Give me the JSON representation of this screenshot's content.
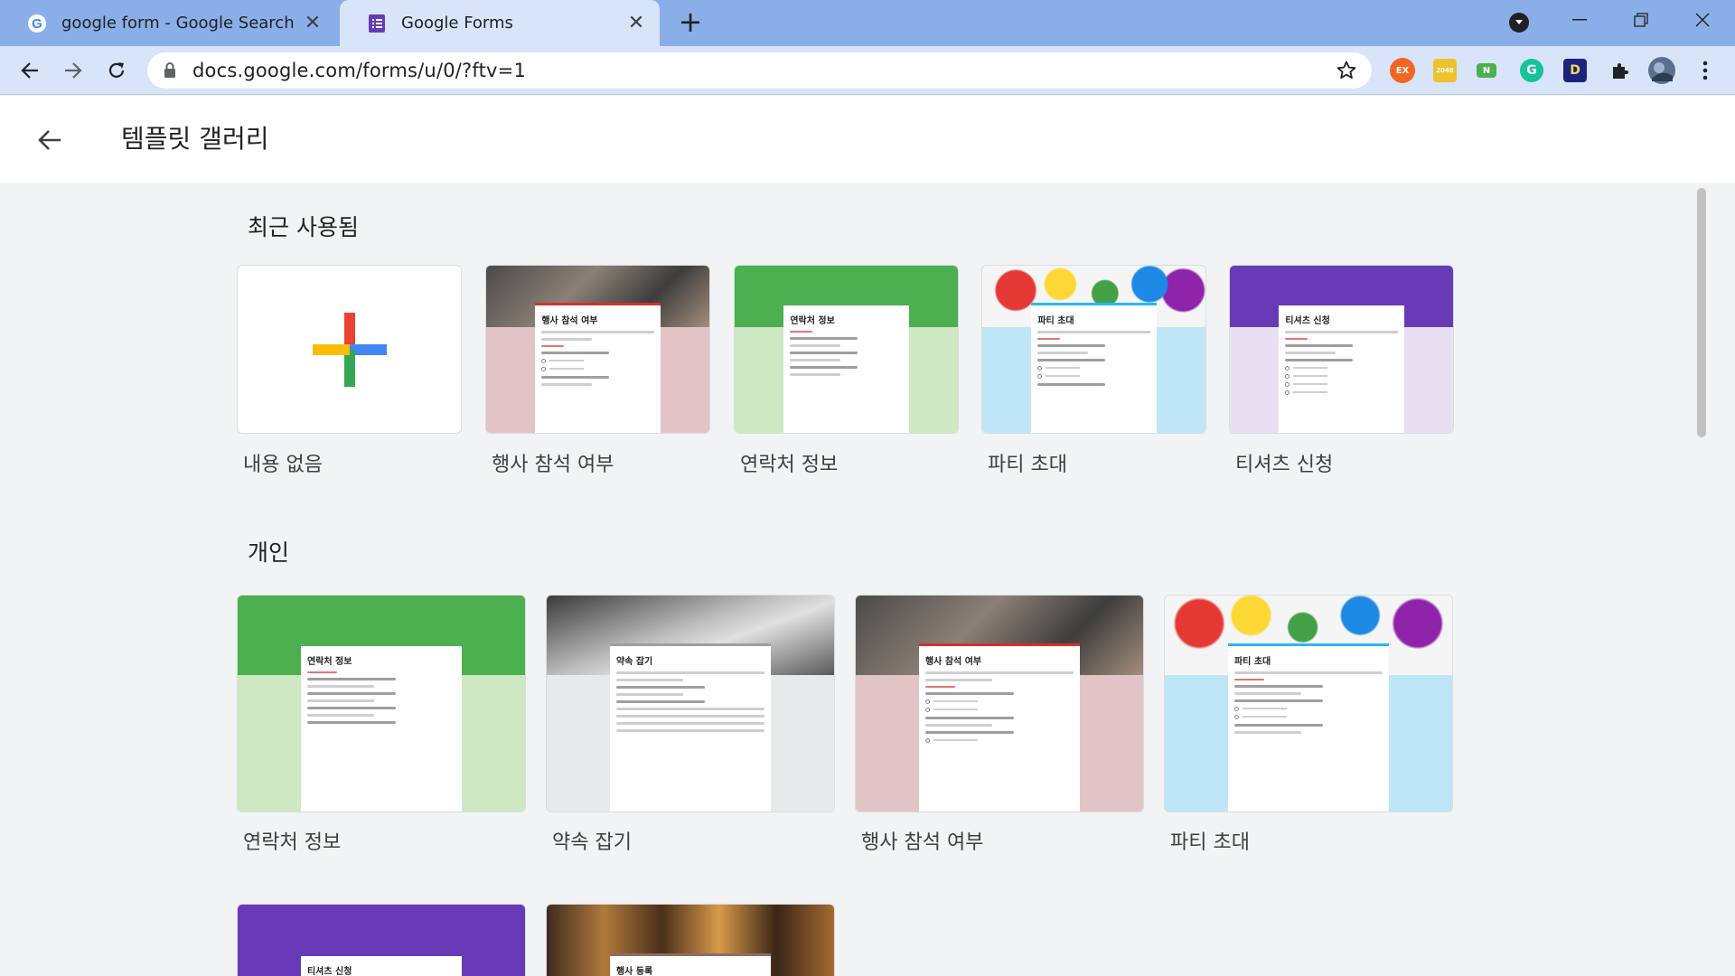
{
  "browser": {
    "tabs": [
      {
        "title": "google form - Google Search",
        "active": false
      },
      {
        "title": "Google Forms",
        "active": true
      }
    ],
    "url": "docs.google.com/forms/u/0/?ftv=1",
    "extensions": [
      "EX",
      "2048",
      "N",
      "G",
      "D"
    ]
  },
  "page": {
    "title": "템플릿 갤러리"
  },
  "sections": {
    "recent": {
      "title": "최근 사용됨",
      "cards": [
        {
          "label": "내용 없음",
          "sheet_title": ""
        },
        {
          "label": "행사 참석 여부",
          "sheet_title": "행사 참석 여부"
        },
        {
          "label": "연락처 정보",
          "sheet_title": "연락처 정보"
        },
        {
          "label": "파티 초대",
          "sheet_title": "파티 초대"
        },
        {
          "label": "티셔츠 신청",
          "sheet_title": "티셔츠 신청"
        }
      ]
    },
    "personal": {
      "title": "개인",
      "cards": [
        {
          "label": "연락처 정보",
          "sheet_title": "연락처 정보"
        },
        {
          "label": "약속 잡기",
          "sheet_title": "약속 잡기"
        },
        {
          "label": "행사 참석 여부",
          "sheet_title": "행사 참석 여부"
        },
        {
          "label": "파티 초대",
          "sheet_title": "파티 초대"
        },
        {
          "label": "",
          "sheet_title": "티셔츠 신청"
        },
        {
          "label": "",
          "sheet_title": "행사 등록"
        }
      ]
    }
  },
  "colors": {
    "tab_strip": "#8aaee8",
    "toolbar": "#d8e4f7",
    "page_bg": "#f1f3f4",
    "green_banner": "#4caf50",
    "green_light": "#cfe8c4",
    "pink_light": "#e3c4c6",
    "blue_light": "#bfe6f7",
    "purple_banner": "#673ab7",
    "purple_light": "#e7e0f3",
    "grey_light": "#e6eaea"
  }
}
